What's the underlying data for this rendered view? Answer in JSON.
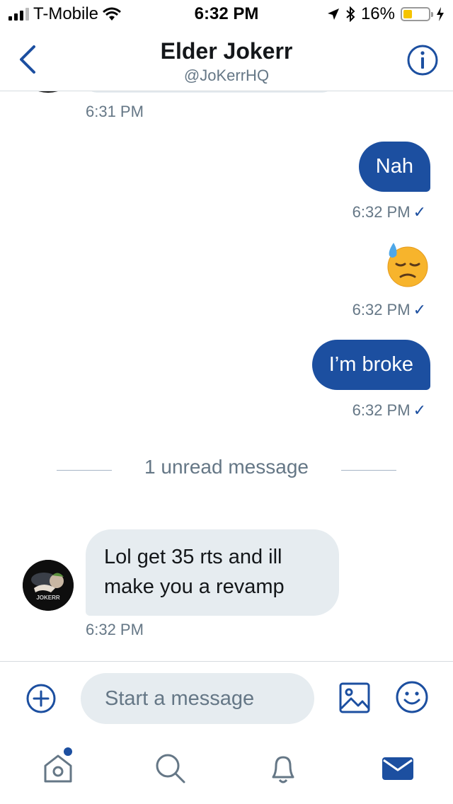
{
  "status_bar": {
    "carrier": "T-Mobile",
    "time": "6:32 PM",
    "battery": "16%",
    "battery_level": 0.16,
    "battery_color": "#f5c400"
  },
  "header": {
    "title": "Elder Jokerr",
    "handle": "@JoKerrHQ",
    "back_icon": "chevron-left-icon",
    "info_icon": "info-icon"
  },
  "messages": [
    {
      "direction": "in",
      "partial": true,
      "time": "6:31 PM"
    },
    {
      "direction": "out",
      "text": "Nah",
      "time": "6:32 PM",
      "read_icon": "✓"
    },
    {
      "direction": "out",
      "emoji": "downcast-face-with-sweat-icon",
      "time": "6:32 PM",
      "read_icon": "✓"
    },
    {
      "direction": "out",
      "text": "I’m broke",
      "time": "6:32 PM",
      "read_icon": "✓"
    }
  ],
  "unread_divider": "1 unread message",
  "incoming": {
    "avatar_text": "JOKERR",
    "text": "Lol get 35 rts and ill make you a revamp",
    "time": "6:32 PM"
  },
  "composer": {
    "placeholder": "Start a message",
    "icons": [
      "plus-circle-icon",
      "image-icon",
      "smiley-icon"
    ]
  },
  "tabbar": {
    "items": [
      "home-icon",
      "search-icon",
      "bell-icon",
      "mail-icon"
    ],
    "active": "mail-icon",
    "home_has_notification": true
  },
  "colors": {
    "accent": "#1c4fa0",
    "bubble_in": "#e6ecf0",
    "secondary_text": "#657786"
  }
}
